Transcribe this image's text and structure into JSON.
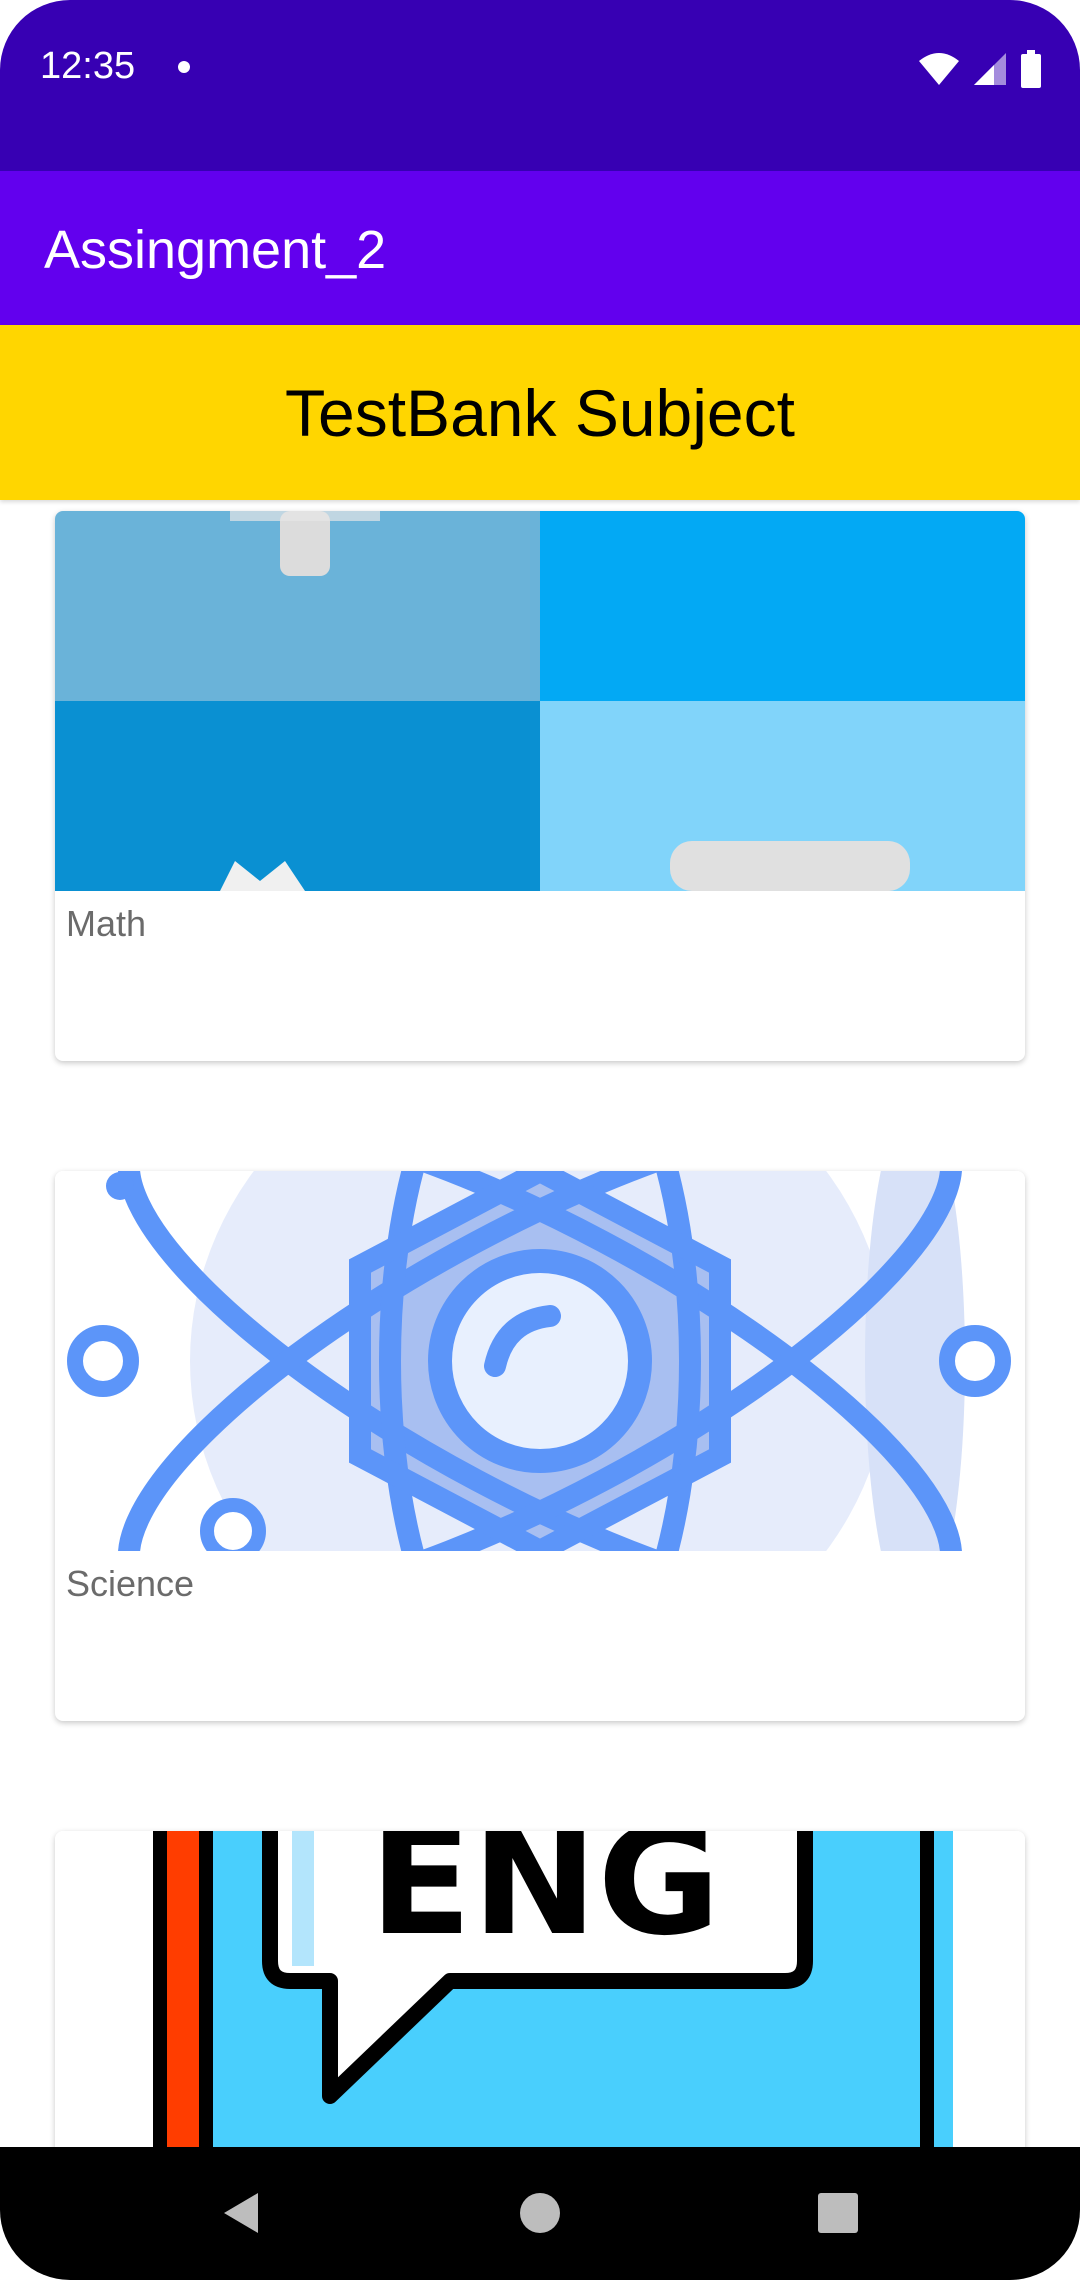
{
  "status_bar": {
    "time": "12:35",
    "icons": [
      "notification-dot-icon",
      "wifi-icon",
      "signal-icon",
      "battery-icon"
    ]
  },
  "app_bar": {
    "title": "Assingment_2",
    "color": "#6200ee"
  },
  "header": {
    "title": "TestBank Subject",
    "color": "#ffd600"
  },
  "subjects": [
    {
      "label": "Math",
      "image": "math-tiles-image"
    },
    {
      "label": "Science",
      "image": "atom-image"
    },
    {
      "label": "",
      "image": "eng-book-image",
      "image_text": "ENG"
    }
  ],
  "nav_bar": {
    "buttons": [
      "back-icon",
      "home-icon",
      "recents-icon"
    ]
  },
  "colors": {
    "status_bar": "#3700b3",
    "accent": "#6200ee",
    "banner": "#ffd600"
  }
}
